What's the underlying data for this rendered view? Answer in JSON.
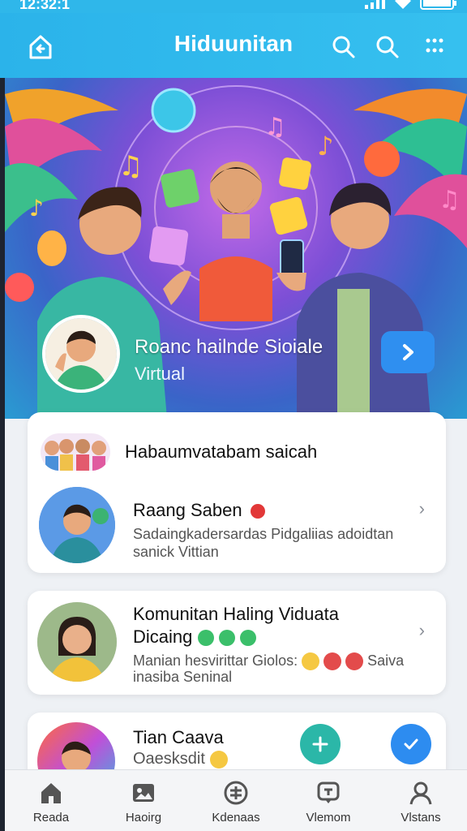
{
  "status": {
    "time": "12:32:1"
  },
  "app": {
    "title": "Hiduunitan"
  },
  "hero": {
    "title": "Roanc hailnde Sioiale",
    "subtitle": "Virtual"
  },
  "card1": {
    "header": "Habaumvatabam saicah",
    "item": {
      "name": "Raang Saben",
      "desc_line1": "Sadaingkadersardas Pidgaliias adoidtan",
      "desc_line2": "sanick Vittian"
    }
  },
  "card2": {
    "title_line1": "Komunitan Haling Viduata",
    "title_line2": "Dicaing",
    "desc_line1": "Manian hesvirittar Giolos:",
    "desc_line1_tail": "Saiva",
    "desc_line2": "inasiba Seninal"
  },
  "card3": {
    "title": "Tian Caava",
    "desc": "Oaesksdit"
  },
  "tabs": [
    {
      "label": "Reada",
      "icon": "home-icon"
    },
    {
      "label": "Haoirg",
      "icon": "media-icon"
    },
    {
      "label": "Kdenaas",
      "icon": "grid-icon"
    },
    {
      "label": "Vlemom",
      "icon": "chat-icon"
    },
    {
      "label": "Vlstans",
      "icon": "profile-icon"
    }
  ],
  "colors": {
    "appbar": "#2bb3ea",
    "accent": "#2f8ff0",
    "fab_green": "#2bb7a8",
    "fab_blue": "#2d8cf0"
  }
}
